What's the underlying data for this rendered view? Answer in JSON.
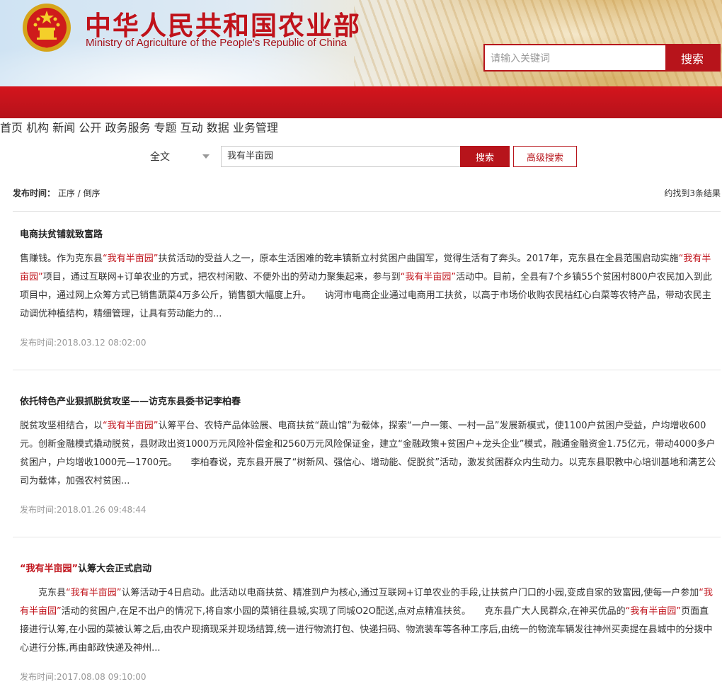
{
  "header": {
    "title_cn": "中华人民共和国农业部",
    "title_en": "Ministry of Agriculture of the People's Republic of China",
    "search_placeholder": "请输入关键词",
    "search_button": "搜索",
    "emblem_icon": "national-emblem-icon",
    "brand_red": "#c0121a"
  },
  "nav": {
    "items": [
      {
        "label": "首页"
      },
      {
        "label": "机构"
      },
      {
        "label": "新闻"
      },
      {
        "label": "公开"
      },
      {
        "label": "政务服务"
      },
      {
        "label": "专题"
      },
      {
        "label": "互动"
      },
      {
        "label": "数据"
      },
      {
        "label": "业务管理"
      }
    ]
  },
  "search": {
    "scope": "全文",
    "query": "我有半亩园",
    "search_button": "搜索",
    "advanced_button": "高级搜索"
  },
  "sort": {
    "label": "发布时间：",
    "asc": "正序",
    "sep": " / ",
    "desc": "倒序",
    "count": "约找到3条结果"
  },
  "results": [
    {
      "title": "电商扶贫铺就致富路",
      "segments": [
        {
          "t": "售赚钱。作为克东县"
        },
        {
          "t": "“我有半亩园”",
          "hl": true
        },
        {
          "t": "扶贫活动的受益人之一，原本生活困难的乾丰镇新立村贫困户曲国军，觉得生活有了奔头。2017年，克东县在全县范围启动实施"
        },
        {
          "t": "“我有半亩园”",
          "hl": true
        },
        {
          "t": "项目，通过互联网+订单农业的方式，把农村闲散、不便外出的劳动力聚集起来，参与到"
        },
        {
          "t": "“我有半亩园”",
          "hl": true
        },
        {
          "t": "活动中。目前，全县有7个乡镇55个贫困村800户农民加入到此项目中，通过网上众筹方式已销售蔬菜4万多公斤，销售额大幅度上升。　　讷河市电商企业通过电商用工扶贫，以高于市场价收购农民桔红心白菜等农特产品，带动农民主动调优种植结构，精细管理，让具有劳动能力的..."
        }
      ],
      "date": "发布时间:2018.03.12 08:02:00"
    },
    {
      "title": "依托特色产业狠抓脱贫攻坚——访克东县委书记李柏春",
      "segments": [
        {
          "t": "脱贫攻坚相结合，以"
        },
        {
          "t": "“我有半亩园”",
          "hl": true
        },
        {
          "t": "认筹平台、农特产品体验展、电商扶贫“蔬山馆”为载体，探索“一户一策、一村一品”发展新模式，使1100户贫困户受益，户均增收600元。创新金融模式撬动脱贫，县财政出资1000万元风险补偿金和2560万元风险保证金，建立“金融政策+贫困户+龙头企业”模式，融通金融资金1.75亿元，带动4000多户贫困户，户均增收1000元—1700元。　　李柏春说，克东县开展了“树新风、强信心、增动能、促脱贫”活动，激发贫困群众内生动力。以克东县职教中心培训基地和满艺公司为载体，加强农村贫困..."
        }
      ],
      "date": "发布时间:2018.01.26 09:48:44"
    },
    {
      "title_hl": "“我有半亩园”",
      "title": "认筹大会正式启动",
      "segments": [
        {
          "t": "　　克东县"
        },
        {
          "t": "“我有半亩园”",
          "hl": true
        },
        {
          "t": "认筹活动于4日启动。此活动以电商扶贫、精准到户为核心,通过互联网+订单农业的手段,让扶贫户门口的小园,变成自家的致富园,使每一户参加"
        },
        {
          "t": "“我有半亩园”",
          "hl": true
        },
        {
          "t": "活动的贫困户,在足不出户的情况下,将自家小园的菜销往县城,实现了同城O2O配送,点对点精准扶贫。　　克东县广大人民群众,在神买优品的"
        },
        {
          "t": "“我有半亩园”",
          "hl": true
        },
        {
          "t": "页面直接进行认筹,在小园的菜被认筹之后,由农户现摘现采并现场结算,统一进行物流打包、快递扫码、物流装车等各种工序后,由统一的物流车辆发往神州买卖提在县城中的分拨中心进行分拣,再由邮政快递及神州..."
        }
      ],
      "date": "发布时间:2017.08.08 09:10:00"
    }
  ]
}
